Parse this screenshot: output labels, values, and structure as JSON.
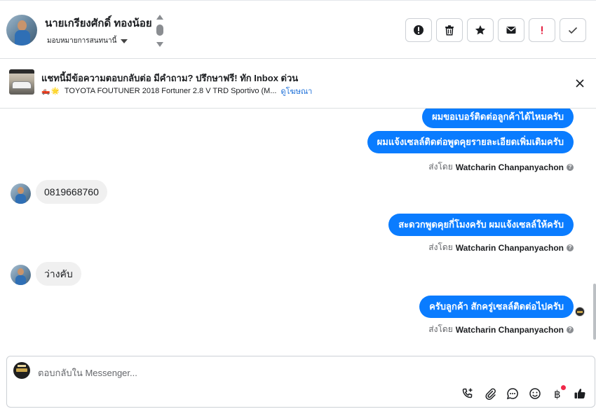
{
  "header": {
    "contact_name": "นายเกรียงศักดิ์ ทองน้อย",
    "assign_label": "มอบหมายการสนทนานี้",
    "actions": [
      {
        "name": "report-button",
        "icon": "alert-circle-icon"
      },
      {
        "name": "delete-button",
        "icon": "trash-icon"
      },
      {
        "name": "star-button",
        "icon": "star-icon"
      },
      {
        "name": "mark-unread-button",
        "icon": "envelope-icon"
      },
      {
        "name": "follow-up-button",
        "icon": "exclamation-icon"
      },
      {
        "name": "mark-done-button",
        "icon": "check-icon"
      }
    ]
  },
  "ad_banner": {
    "title": "แชทนี้มีข้อความตอบกลับต่อ มีคำถาม? ปรึกษาฟรี! ทัก Inbox ด่วน",
    "subtitle_emoji": "🛻🌟",
    "subtitle": "TOYOTA FOUTUNER 2018 Fortuner 2.8 V TRD Sportivo (M...",
    "link": "ดูโฆษณา"
  },
  "messages": [
    {
      "dir": "out",
      "text": "ผมขอเบอร์ติดต่อลูกค้าได้ไหมครับ"
    },
    {
      "dir": "out",
      "text": "ผมแจ้งเซลล์ติดต่อพูดคุยรายละเอียดเพิ่มเติมครับ"
    },
    {
      "dir": "sent",
      "prefix": "ส่งโดย",
      "sender": "Watcharin Chanpanyachon"
    },
    {
      "dir": "in",
      "text": "0819668760"
    },
    {
      "dir": "out",
      "text": "สะดวกพูดคุยกี่โมงครับ ผมแจ้งเซลล์ให้ครับ"
    },
    {
      "dir": "sent",
      "prefix": "ส่งโดย",
      "sender": "Watcharin Chanpanyachon"
    },
    {
      "dir": "in",
      "text": "ว่างคับ"
    },
    {
      "dir": "out",
      "text": "ครับลูกค้า สักครู่เซลล์ติดต่อไปครับ"
    },
    {
      "dir": "sent",
      "prefix": "ส่งโดย",
      "sender": "Watcharin Chanpanyachon"
    }
  ],
  "composer": {
    "placeholder": "ตอบกลับใน Messenger...",
    "tools": [
      "phone-plus-icon",
      "paperclip-icon",
      "chat-bubble-icon",
      "emoji-icon",
      "baht-icon",
      "thumbs-up-icon"
    ]
  },
  "colors": {
    "bubble_out": "#0a7cff",
    "bubble_in": "#f0f0f0",
    "link": "#1a6ed8",
    "follow_up": "#e41e3f"
  }
}
